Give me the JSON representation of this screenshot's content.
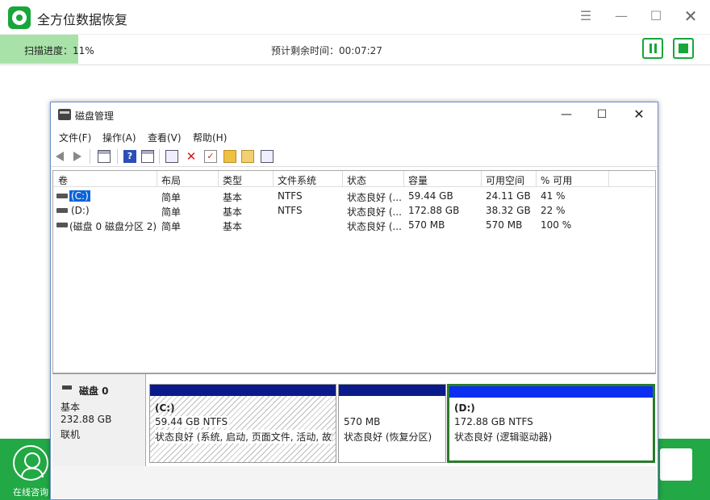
{
  "app": {
    "title": "全方位数据恢复",
    "progress_label": "扫描进度：11%",
    "progress_value": 0.11,
    "remaining_label": "预计剩余时间：00:07:27",
    "consult_label": "在线咨询",
    "accent_color": "#22a845"
  },
  "disk_mgmt": {
    "title": "磁盘管理",
    "menu": [
      "文件(F)",
      "操作(A)",
      "查看(V)",
      "帮助(H)"
    ],
    "columns": [
      "卷",
      "布局",
      "类型",
      "文件系统",
      "状态",
      "容量",
      "可用空间",
      "% 可用"
    ],
    "volumes": [
      {
        "name": "(C:)",
        "layout": "简单",
        "type": "基本",
        "fs": "NTFS",
        "status": "状态良好 (...",
        "capacity": "59.44 GB",
        "free": "24.11 GB",
        "pct": "41 %"
      },
      {
        "name": "(D:)",
        "layout": "简单",
        "type": "基本",
        "fs": "NTFS",
        "status": "状态良好 (...",
        "capacity": "172.88 GB",
        "free": "38.32 GB",
        "pct": "22 %"
      },
      {
        "name": "(磁盘 0 磁盘分区 2)",
        "layout": "简单",
        "type": "基本",
        "fs": "",
        "status": "状态良好 (...",
        "capacity": "570 MB",
        "free": "570 MB",
        "pct": "100 %"
      }
    ],
    "disk": {
      "name": "磁盘 0",
      "kind": "基本",
      "size": "232.88 GB",
      "state": "联机"
    },
    "partitions": [
      {
        "label": "(C:)",
        "size": "59.44 GB NTFS",
        "status": "状态良好 (系统, 启动, 页面文件, 活动, 故障"
      },
      {
        "label": "",
        "size": "570 MB",
        "status": "状态良好 (恢复分区)"
      },
      {
        "label": "(D:)",
        "size": "172.88 GB NTFS",
        "status": "状态良好 (逻辑驱动器)"
      }
    ]
  }
}
